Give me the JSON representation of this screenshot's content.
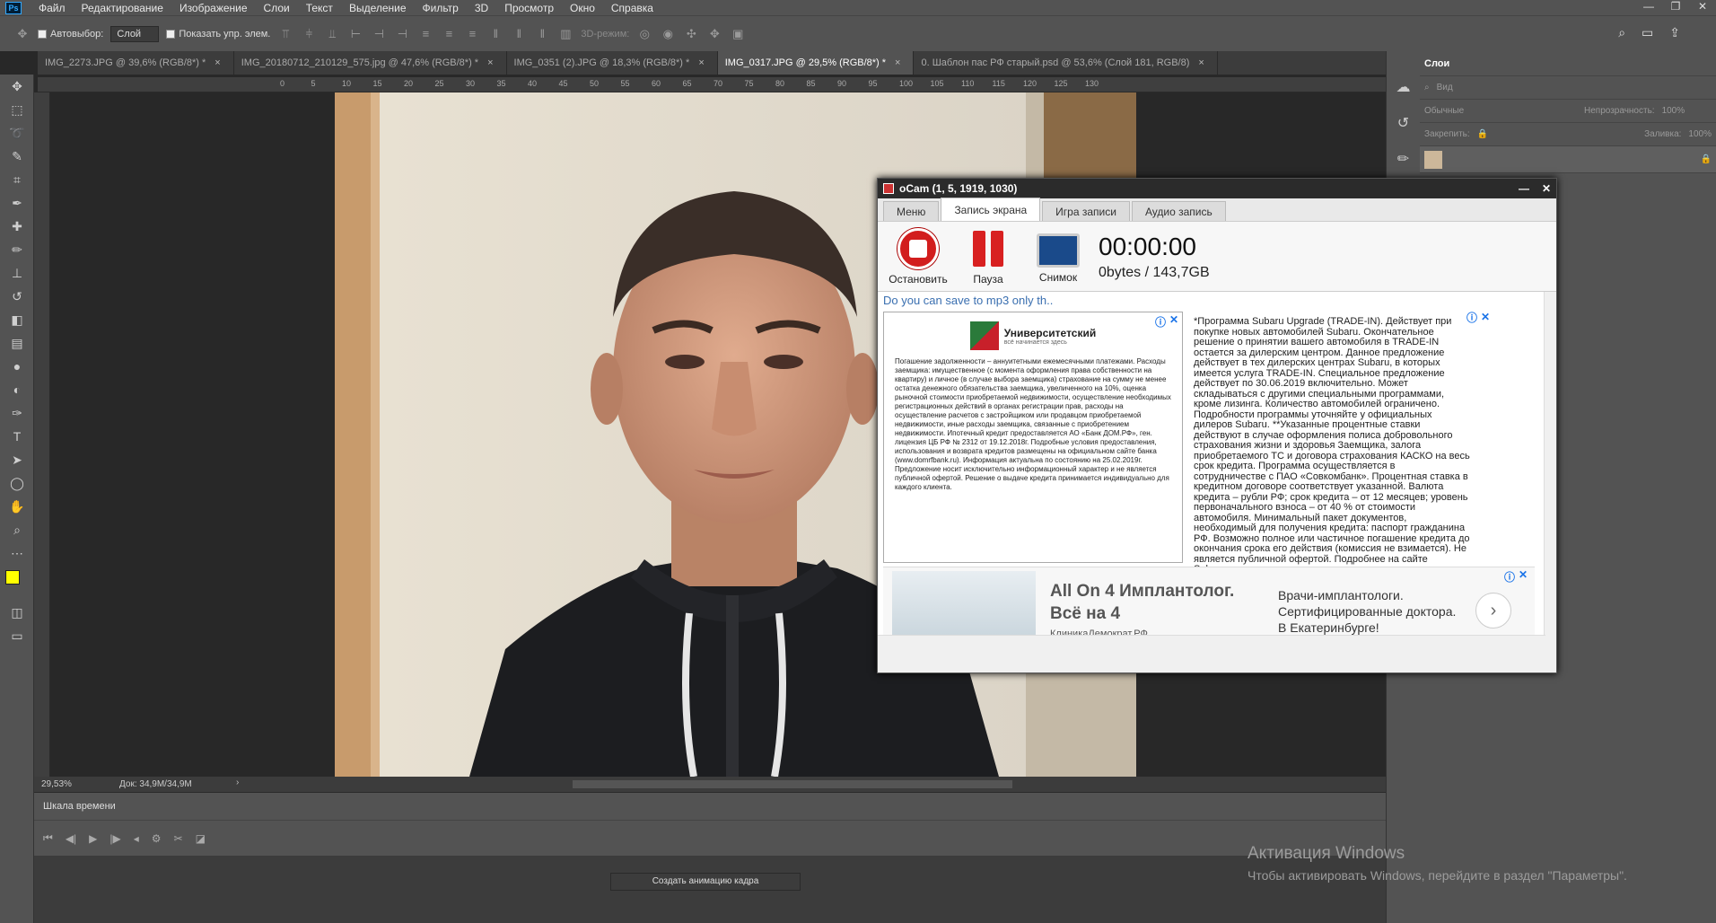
{
  "app": {
    "menu": [
      "Файл",
      "Редактирование",
      "Изображение",
      "Слои",
      "Текст",
      "Выделение",
      "Фильтр",
      "3D",
      "Просмотр",
      "Окно",
      "Справка"
    ],
    "logo": "Ps"
  },
  "options": {
    "autoselect_label": "Автовыбор:",
    "autoselect_value": "Слой",
    "show_controls_label": "Показать упр. элем.",
    "mode3d_label": "3D-режим:"
  },
  "tabs": [
    {
      "label": "IMG_2273.JPG @ 39,6% (RGB/8*) *"
    },
    {
      "label": "IMG_20180712_210129_575.jpg @ 47,6% (RGB/8*) *"
    },
    {
      "label": "IMG_0351 (2).JPG @ 18,3% (RGB/8*) *"
    },
    {
      "label": "IMG_0317.JPG @ 29,5% (RGB/8*) *"
    },
    {
      "label": "0. Шаблон пас РФ старый.psd @ 53,6% (Слой 181, RGB/8)"
    }
  ],
  "ruler_top": [
    "0",
    "5",
    "10",
    "15",
    "20",
    "25",
    "30",
    "35",
    "40",
    "45",
    "50",
    "55",
    "60",
    "65",
    "70",
    "75",
    "80",
    "85",
    "90",
    "95",
    "100",
    "105",
    "110",
    "115",
    "120",
    "125",
    "130"
  ],
  "status": {
    "zoom": "29,53%",
    "doc": "Док: 34,9M/34,9M"
  },
  "timeline": {
    "title": "Шкала времени",
    "create_button": "Создать анимацию кадра"
  },
  "layers": {
    "title": "Слои",
    "search_placeholder": "Вид",
    "blend_mode": "Обычные",
    "opacity_label": "Непрозрачность:",
    "opacity_value": "100%",
    "lock_label": "Закрепить:",
    "fill_label": "Заливка:",
    "fill_value": "100%"
  },
  "activation": {
    "title": "Активация Windows",
    "subtitle": "Чтобы активировать Windows, перейдите в раздел \"Параметры\"."
  },
  "ocam": {
    "title": "oCam (1, 5, 1919, 1030)",
    "tabs": [
      "Меню",
      "Запись экрана",
      "Игра записи",
      "Аудио запись"
    ],
    "stop_label": "Остановить",
    "pause_label": "Пауза",
    "snapshot_label": "Снимок",
    "time": "00:00:00",
    "size": "0bytes / 143,7GB",
    "ad_link": "Do you can save to mp3 only th..",
    "ad1": {
      "bank_name": "Университетский",
      "bank_sub": "всё начинается здесь",
      "text": "Погашение задолженности – аннуитетными ежемесячными платежами. Расходы заемщика: имущественное (с момента оформления права собственности на квартиру) и личное (в случае выбора заемщика) страхование на сумму не менее остатка денежного обязательства заемщика, увеличенного на 10%, оценка рыночной стоимости приобретаемой недвижимости, осуществление необходимых регистрационных действий в органах регистрации прав, расходы на осуществление расчетов с застройщиком или продавцом приобретаемой недвижимости, иные расходы заемщика, связанные с приобретением недвижимости. Ипотечный кредит предоставляется АО «Банк ДОМ.РФ», ген. лицензия ЦБ РФ № 2312 от 19.12.2018г. Подробные условия предоставления, использования и возврата кредитов размещены на официальном сайте банка (www.domrfbank.ru). Информация актуальна по состоянию на 25.02.2019г. Предложение носит исключительно информационный характер и не является публичной офертой. Решение о выдаче кредита принимается индивидуально для каждого клиента."
    },
    "ad2": {
      "text": "*Программа Subaru Upgrade (TRADE-IN). Действует при покупке новых автомобилей Subaru. Окончательное решение о принятии вашего автомобиля в TRADE-IN остается за дилерским центром. Данное предложение действует в тех дилерских центрах Subaru, в которых имеется услуга TRADE-IN. Специальное предложение действует по 30.06.2019 включительно. Может складываться с другими специальными программами, кроме лизинга. Количество автомобилей ограничено. Подробности программы уточняйте у официальных дилеров Subaru. **Указанные процентные ставки действуют в случае оформления полиса добровольного страхования жизни и здоровья Заемщика, залога приобретаемого ТС и договора страхования КАСКО на весь срок кредита. Программа осуществляется в сотрудничестве с ПАО «Совкомбанк». Процентная ставка в кредитном договоре соответствует указанной. Валюта кредита – рубли РФ; срок кредита – от 12 месяцев; уровень первоначального взноса – от 40 % от стоимости автомобиля. Минимальный пакет документов, необходимый для получения кредита: паспорт гражданина РФ. Возможно полное или частичное погашение кредита до окончания срока его действия (комиссия не взимается). Не является публичной офертой. Подробнее на сайте Subaru.ru."
    },
    "ad3": {
      "headline": "All On 4 Имплантолог. Всё на 4",
      "source": "КлиникаДемократ.РФ",
      "desc": "Врачи-имплантологи. Сертифицированные доктора. В Екатеринбурге!"
    }
  }
}
